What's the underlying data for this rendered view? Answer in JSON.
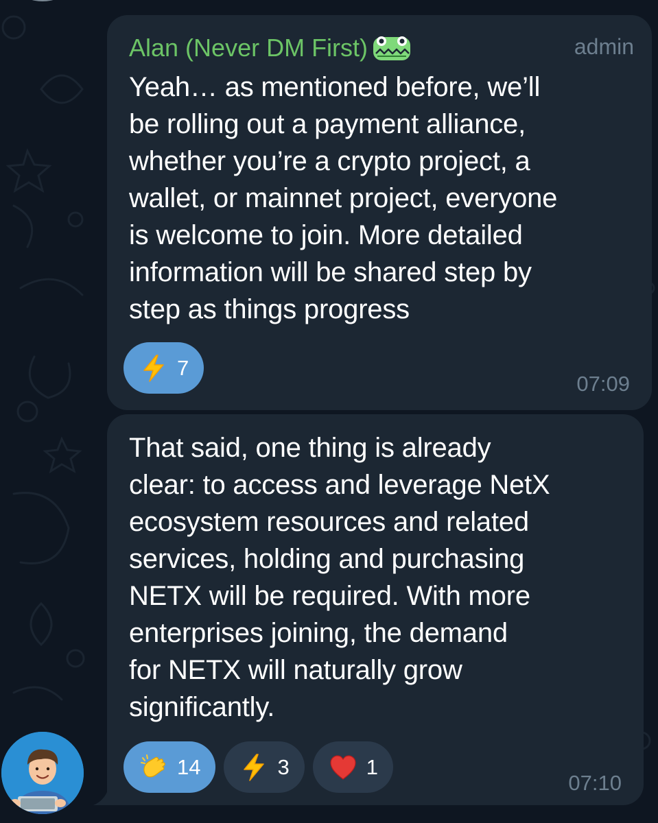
{
  "chat": {
    "messages": [
      {
        "sender": "Alan (Never DM First)",
        "badge": "admin",
        "text": "Yeah… as mentioned before, we’ll\nbe rolling out a payment alliance,\nwhether you’re a crypto project, a\nwallet, or mainnet project, everyone\nis welcome to join. More detailed\ninformation will be shared step by\nstep as things progress",
        "time": "07:09",
        "reactions": [
          {
            "icon": "lightning-icon",
            "count": "7",
            "selected": true
          }
        ]
      },
      {
        "text": "That said, one thing is already\nclear: to access and leverage NetX\necosystem resources and related\nservices, holding and purchasing\nNETX will be required. With more\nenterprises joining, the demand\nfor NETX will naturally grow\nsignificantly.",
        "time": "07:10",
        "reactions": [
          {
            "icon": "clapping-hands-icon",
            "count": "14",
            "selected": true
          },
          {
            "icon": "lightning-icon",
            "count": "3",
            "selected": false
          },
          {
            "icon": "heart-icon",
            "count": "1",
            "selected": false
          }
        ]
      }
    ]
  },
  "colors": {
    "background": "#0e1621",
    "bubble": "#1c2733",
    "sender_name": "#6cc466",
    "meta_text": "#6d7f8f",
    "reaction_selected": "#5a9bd6",
    "reaction_default": "#2b3a4b"
  }
}
